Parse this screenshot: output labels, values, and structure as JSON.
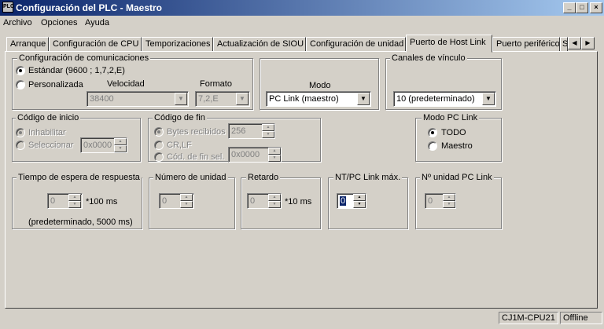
{
  "window": {
    "title": "Configuración del PLC - Maestro",
    "icon": "plc-app-icon",
    "controls": [
      "_",
      "□",
      "×"
    ]
  },
  "menu": [
    "Archivo",
    "Opciones",
    "Ayuda"
  ],
  "tabs": [
    {
      "label": "Arranque",
      "active": false
    },
    {
      "label": "Configuración de CPU",
      "active": false
    },
    {
      "label": "Temporizaciones",
      "active": false
    },
    {
      "label": "Actualización de SIOU",
      "active": false
    },
    {
      "label": "Configuración de unidad",
      "active": false
    },
    {
      "label": "Puerto de Host Link",
      "active": true
    },
    {
      "label": "Puerto periférico",
      "active": false
    },
    {
      "label": "S",
      "active": false
    }
  ],
  "comms": {
    "legend": "Configuración de comunicaciones",
    "standard_label": "Estándar (9600 ; 1,7,2,E)",
    "custom_label": "Personalizada",
    "selected": "standard",
    "speed_label": "Velocidad",
    "speed_value": "38400",
    "format_label": "Formato",
    "format_value": "7,2,E"
  },
  "mode": {
    "label": "Modo",
    "value": "PC Link (maestro)"
  },
  "link_channels": {
    "legend": "Canales de vínculo",
    "value": "10 (predeterminado)"
  },
  "start_code": {
    "legend": "Código de inicio",
    "disable_label": "Inhabilitar",
    "select_label": "Seleccionar",
    "selected": "disable",
    "value": "0x0000"
  },
  "end_code": {
    "legend": "Código de fin",
    "bytes_label": "Bytes recibidos",
    "bytes_value": "256",
    "crlf_label": "CR,LF",
    "endsel_label": "Cód. de fin sel.",
    "endsel_value": "0x0000",
    "selected": "bytes"
  },
  "pclink_mode": {
    "legend": "Modo PC Link",
    "all_label": "TODO",
    "master_label": "Maestro",
    "selected": "all"
  },
  "response_timeout": {
    "legend": "Tiempo de espera de respuesta",
    "value": "0",
    "unit": "*100 ms",
    "note": "(predeterminado, 5000 ms)"
  },
  "unit_number": {
    "legend": "Número de unidad",
    "value": "0"
  },
  "delay": {
    "legend": "Retardo",
    "value": "0",
    "unit": "*10 ms"
  },
  "nt_pclink_max": {
    "legend": "NT/PC Link máx.",
    "value": "0"
  },
  "pclink_unit_no": {
    "legend": "Nº unidad PC Link",
    "value": "0"
  },
  "status": {
    "model": "CJ1M-CPU21",
    "connection": "Offline"
  }
}
